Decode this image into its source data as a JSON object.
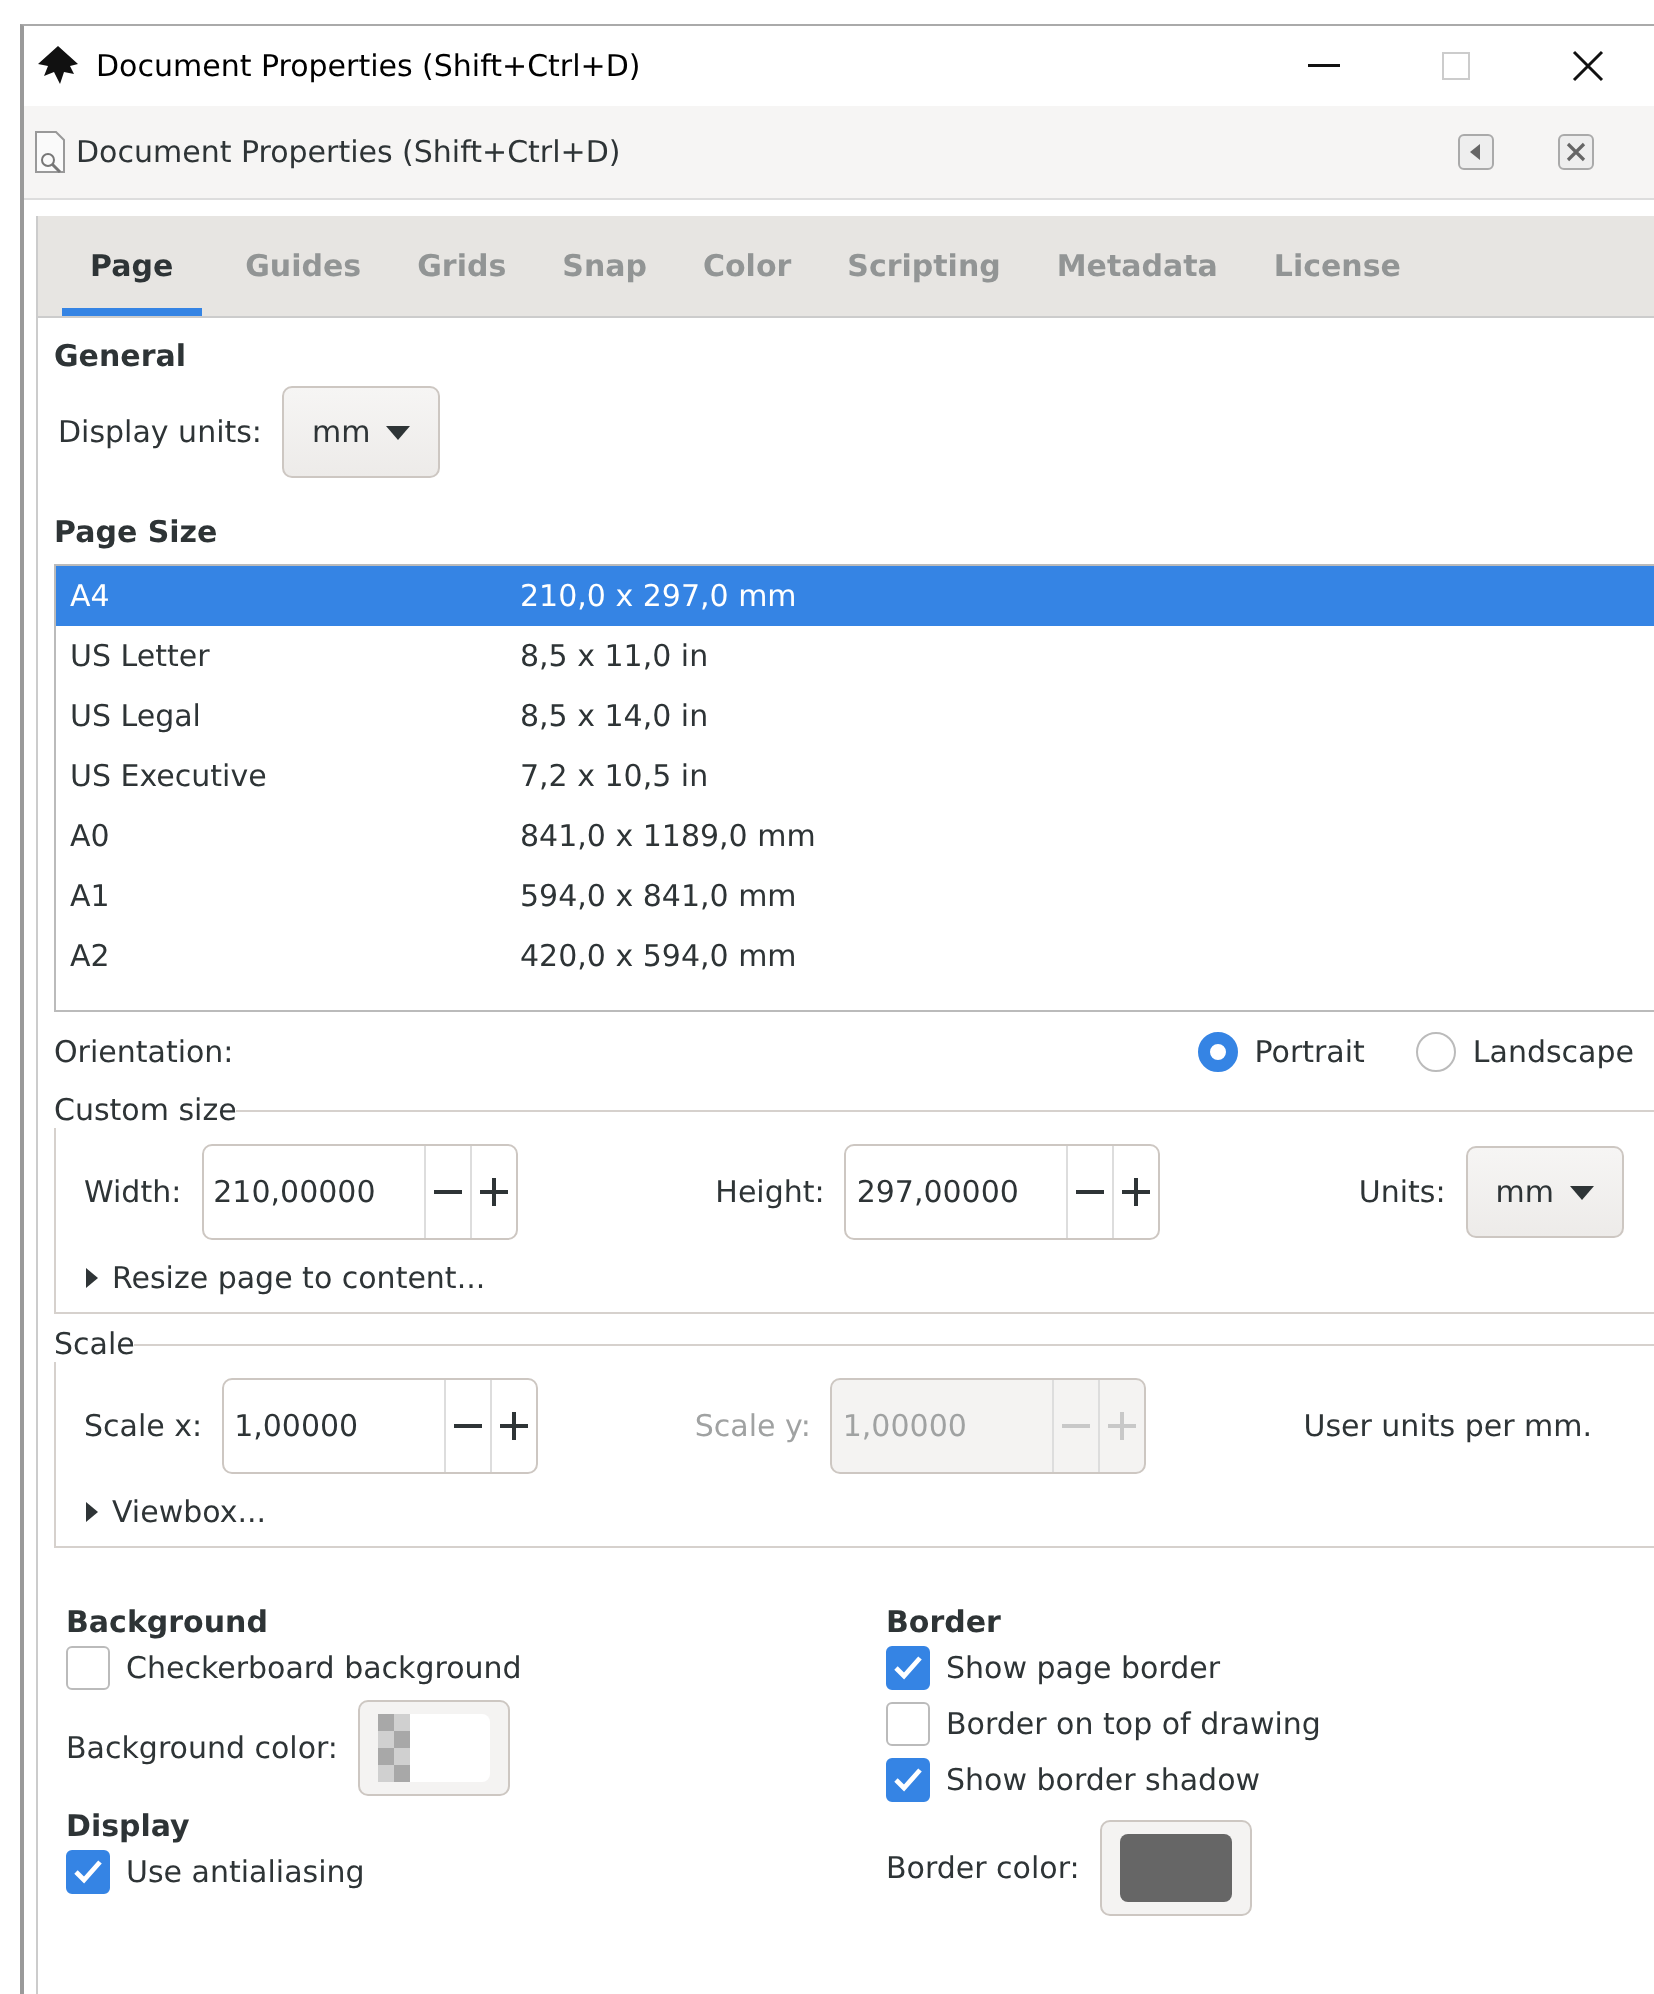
{
  "window": {
    "title": "Document Properties (Shift+Ctrl+D)"
  },
  "dock": {
    "title": "Document Properties (Shift+Ctrl+D)"
  },
  "tabs": [
    {
      "label": "Page",
      "selected": true
    },
    {
      "label": "Guides",
      "selected": false
    },
    {
      "label": "Grids",
      "selected": false
    },
    {
      "label": "Snap",
      "selected": false
    },
    {
      "label": "Color",
      "selected": false
    },
    {
      "label": "Scripting",
      "selected": false
    },
    {
      "label": "Metadata",
      "selected": false
    },
    {
      "label": "License",
      "selected": false
    }
  ],
  "general": {
    "heading": "General",
    "display_units": {
      "label": "Display units:",
      "value": "mm"
    }
  },
  "page_size": {
    "heading": "Page Size",
    "rows": [
      {
        "name": "A4",
        "size": "210,0 x 297,0 mm",
        "selected": true
      },
      {
        "name": "US Letter",
        "size": "8,5 x 11,0 in",
        "selected": false
      },
      {
        "name": "US Legal",
        "size": "8,5 x 14,0 in",
        "selected": false
      },
      {
        "name": "US Executive",
        "size": "7,2 x 10,5 in",
        "selected": false
      },
      {
        "name": "A0",
        "size": "841,0 x 1189,0 mm",
        "selected": false
      },
      {
        "name": "A1",
        "size": "594,0 x 841,0 mm",
        "selected": false
      },
      {
        "name": "A2",
        "size": "420,0 x 594,0 mm",
        "selected": false
      }
    ]
  },
  "orientation": {
    "label": "Orientation:",
    "options": [
      {
        "label": "Portrait",
        "selected": true
      },
      {
        "label": "Landscape",
        "selected": false
      }
    ]
  },
  "custom_size": {
    "legend": "Custom size",
    "width": {
      "label": "Width:",
      "value": "210,00000",
      "disabled": false
    },
    "height": {
      "label": "Height:",
      "value": "297,00000",
      "disabled": false
    },
    "units": {
      "label": "Units:",
      "value": "mm"
    },
    "expander": "Resize page to content..."
  },
  "scale": {
    "legend": "Scale",
    "scale_x": {
      "label": "Scale x:",
      "value": "1,00000",
      "disabled": false
    },
    "scale_y": {
      "label": "Scale y:",
      "value": "1,00000",
      "disabled": true
    },
    "note": "User units per mm.",
    "expander": "Viewbox..."
  },
  "background": {
    "heading": "Background",
    "checkboxes": [
      {
        "label": "Checkerboard background",
        "checked": false
      }
    ],
    "color_label": "Background color:"
  },
  "display": {
    "heading": "Display",
    "checkboxes": [
      {
        "label": "Use antialiasing",
        "checked": true
      }
    ]
  },
  "border": {
    "heading": "Border",
    "checkboxes": [
      {
        "label": "Show page border",
        "checked": true
      },
      {
        "label": "Border on top of drawing",
        "checked": false
      },
      {
        "label": "Show border shadow",
        "checked": true
      }
    ],
    "color_label": "Border color:",
    "color": "#666666"
  }
}
